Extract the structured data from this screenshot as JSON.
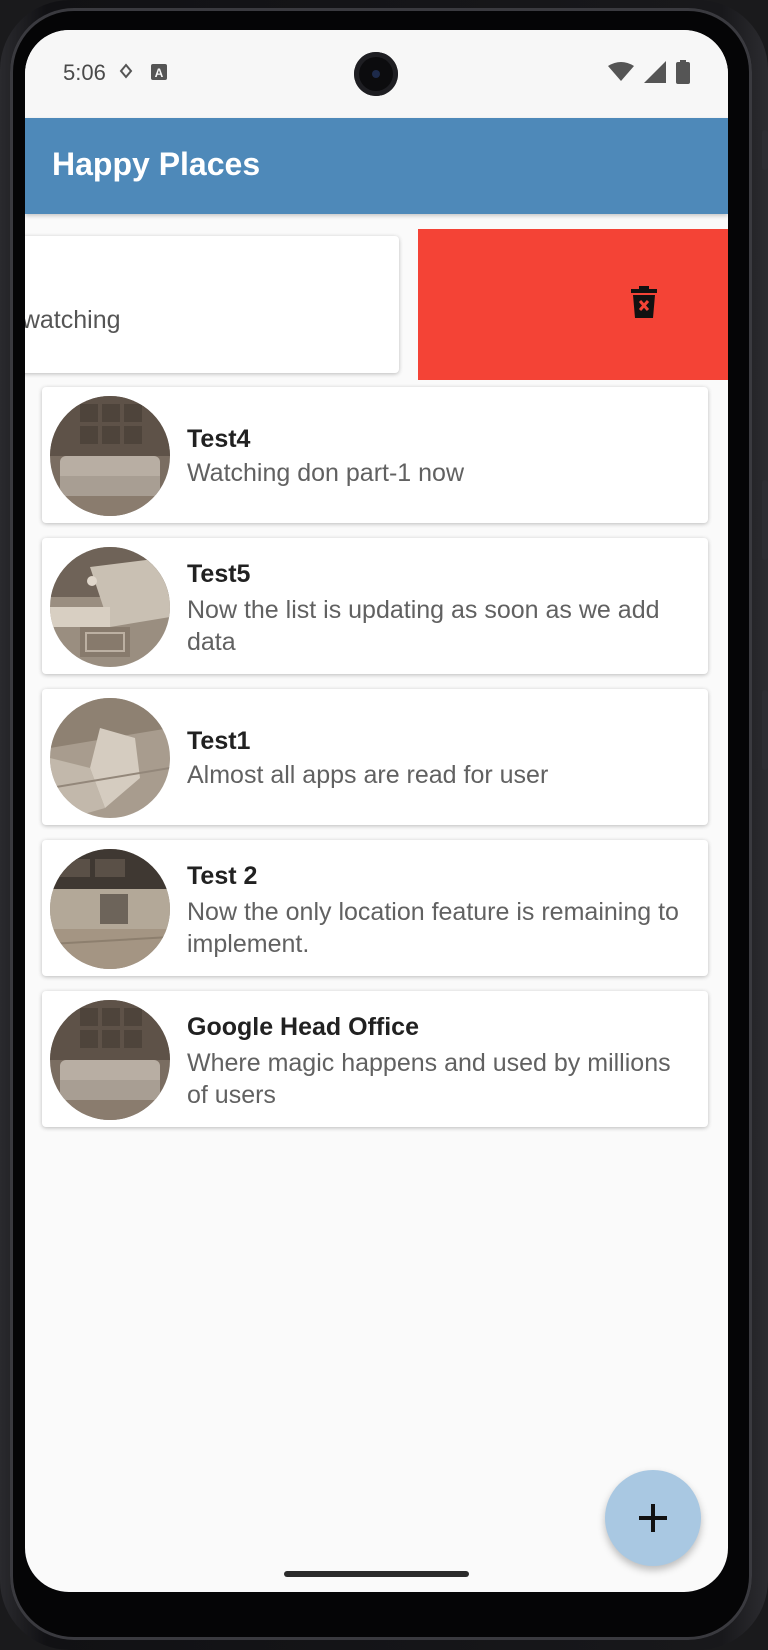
{
  "status_bar": {
    "time": "5:06"
  },
  "app_bar": {
    "title": "Happy Places"
  },
  "swipe_row": {
    "partial_text": "e watching",
    "action_icon": "delete-icon",
    "action_color": "#f44336"
  },
  "places": [
    {
      "title": "Test4",
      "description": "Watching don part-1 now",
      "image": "living-room-photo"
    },
    {
      "title": "Test5",
      "description": "Now the list is updating as soon as we add data",
      "image": "sofa-room-photo"
    },
    {
      "title": "Test1",
      "description": "Almost all apps are read for user",
      "image": "floor-photo"
    },
    {
      "title": "Test 2",
      "description": "Now the only location feature is remaining to implement.",
      "image": "kitchen-photo"
    },
    {
      "title": "Google Head Office",
      "description": "Where magic happens and used by millions of users",
      "image": "living-room-photo"
    }
  ],
  "fab": {
    "icon": "plus-icon"
  },
  "colors": {
    "app_bar": "#4e89b9",
    "delete": "#f44336",
    "fab": "#a9c8e2"
  }
}
